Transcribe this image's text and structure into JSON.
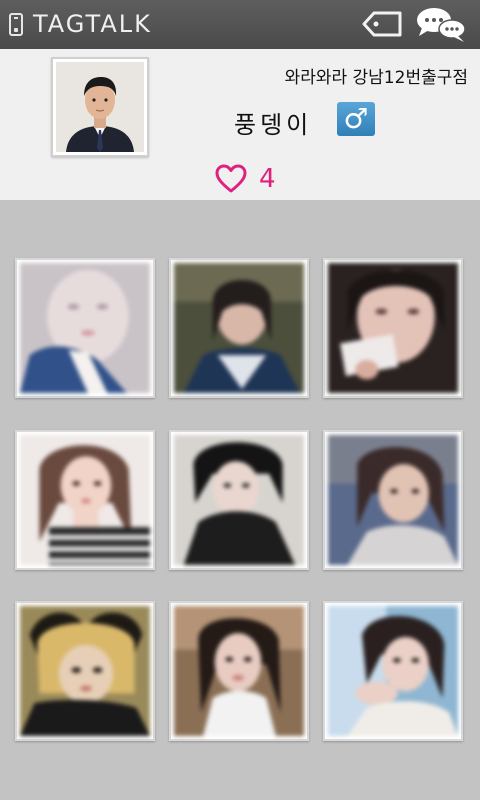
{
  "header": {
    "app_title": "TAGTALK",
    "left_icon": "phone-icon",
    "tag_icon": "tag-icon",
    "chat_icon": "chat-bubbles-icon"
  },
  "profile": {
    "store_name": "와라와라 강남12번출구점",
    "nickname": "풍뎅이",
    "gender_symbol": "♂",
    "like_icon": "heart-icon",
    "like_count": "4",
    "colors": {
      "accent_pink": "#e0207e",
      "gender_blue": "#2f7fb8"
    }
  },
  "photos": [
    {
      "name": "photo-1"
    },
    {
      "name": "photo-2"
    },
    {
      "name": "photo-3"
    },
    {
      "name": "photo-4"
    },
    {
      "name": "photo-5"
    },
    {
      "name": "photo-6"
    },
    {
      "name": "photo-7"
    },
    {
      "name": "photo-8"
    },
    {
      "name": "photo-9"
    }
  ]
}
